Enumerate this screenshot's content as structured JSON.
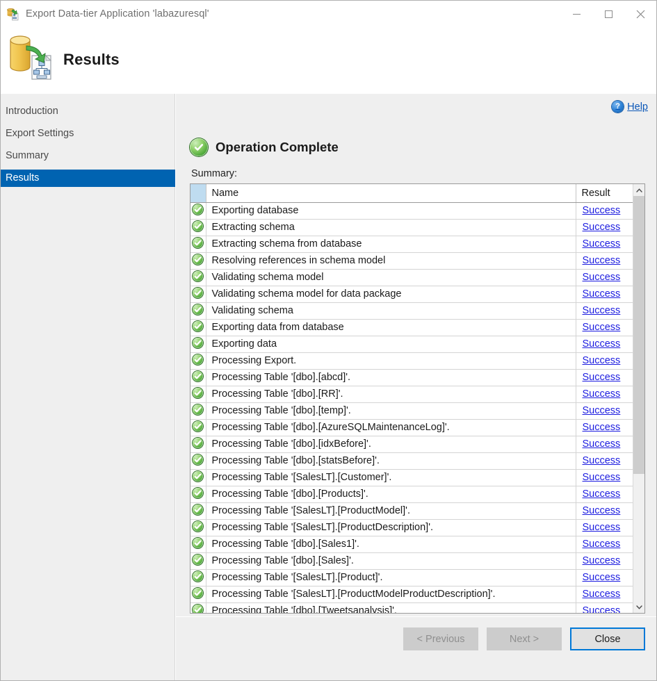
{
  "window": {
    "title": "Export Data-tier Application 'labazuresql'",
    "icon": "export-data-tier-icon",
    "controls": {
      "minimize": "minimize-icon",
      "maximize": "maximize-icon",
      "close": "close-icon"
    }
  },
  "header": {
    "title": "Results",
    "icon": "database-export-icon"
  },
  "sidebar": {
    "items": [
      {
        "label": "Introduction",
        "selected": false
      },
      {
        "label": "Export Settings",
        "selected": false
      },
      {
        "label": "Summary",
        "selected": false
      },
      {
        "label": "Results",
        "selected": true
      }
    ],
    "selected_color": "#0063b1"
  },
  "content": {
    "help": {
      "label": "Help",
      "icon": "help-icon",
      "color": "#0b57b8"
    },
    "status": {
      "title": "Operation Complete",
      "icon": "success-check-icon",
      "icon_color": "#4ea83a"
    },
    "summary_label": "Summary:"
  },
  "grid": {
    "columns": [
      "",
      "Name",
      "Result"
    ],
    "header_icon_cell_color": "#bfdcf0",
    "result_link_color": "#1c1ce0",
    "rows": [
      {
        "status": "success-check-icon",
        "name": "Exporting database",
        "result": "Success"
      },
      {
        "status": "success-check-icon",
        "name": "Extracting schema",
        "result": "Success"
      },
      {
        "status": "success-check-icon",
        "name": "Extracting schema from database",
        "result": "Success"
      },
      {
        "status": "success-check-icon",
        "name": "Resolving references in schema model",
        "result": "Success"
      },
      {
        "status": "success-check-icon",
        "name": "Validating schema model",
        "result": "Success"
      },
      {
        "status": "success-check-icon",
        "name": "Validating schema model for data package",
        "result": "Success"
      },
      {
        "status": "success-check-icon",
        "name": "Validating schema",
        "result": "Success"
      },
      {
        "status": "success-check-icon",
        "name": "Exporting data from database",
        "result": "Success"
      },
      {
        "status": "success-check-icon",
        "name": "Exporting data",
        "result": "Success"
      },
      {
        "status": "success-check-icon",
        "name": "Processing Export.",
        "result": "Success"
      },
      {
        "status": "success-check-icon",
        "name": "Processing Table '[dbo].[abcd]'.",
        "result": "Success"
      },
      {
        "status": "success-check-icon",
        "name": "Processing Table '[dbo].[RR]'.",
        "result": "Success"
      },
      {
        "status": "success-check-icon",
        "name": "Processing Table '[dbo].[temp]'.",
        "result": "Success"
      },
      {
        "status": "success-check-icon",
        "name": "Processing Table '[dbo].[AzureSQLMaintenanceLog]'.",
        "result": "Success"
      },
      {
        "status": "success-check-icon",
        "name": "Processing Table '[dbo].[idxBefore]'.",
        "result": "Success"
      },
      {
        "status": "success-check-icon",
        "name": "Processing Table '[dbo].[statsBefore]'.",
        "result": "Success"
      },
      {
        "status": "success-check-icon",
        "name": "Processing Table '[SalesLT].[Customer]'.",
        "result": "Success"
      },
      {
        "status": "success-check-icon",
        "name": "Processing Table '[dbo].[Products]'.",
        "result": "Success"
      },
      {
        "status": "success-check-icon",
        "name": "Processing Table '[SalesLT].[ProductModel]'.",
        "result": "Success"
      },
      {
        "status": "success-check-icon",
        "name": "Processing Table '[SalesLT].[ProductDescription]'.",
        "result": "Success"
      },
      {
        "status": "success-check-icon",
        "name": "Processing Table '[dbo].[Sales1]'.",
        "result": "Success"
      },
      {
        "status": "success-check-icon",
        "name": "Processing Table '[dbo].[Sales]'.",
        "result": "Success"
      },
      {
        "status": "success-check-icon",
        "name": "Processing Table '[SalesLT].[Product]'.",
        "result": "Success"
      },
      {
        "status": "success-check-icon",
        "name": "Processing Table '[SalesLT].[ProductModelProductDescription]'.",
        "result": "Success"
      },
      {
        "status": "success-check-icon",
        "name": "Processing Table '[dbo].[Tweetsanalysis]'.",
        "result": "Success"
      }
    ],
    "scrollbar": {
      "up_arrow": "chevron-up-icon",
      "down_arrow": "chevron-down-icon",
      "thumb_position": "top"
    }
  },
  "footer": {
    "previous_label": "< Previous",
    "next_label": "Next >",
    "close_label": "Close",
    "previous_enabled": false,
    "next_enabled": false,
    "default_button": "Close",
    "focus_color": "#0078d7"
  }
}
